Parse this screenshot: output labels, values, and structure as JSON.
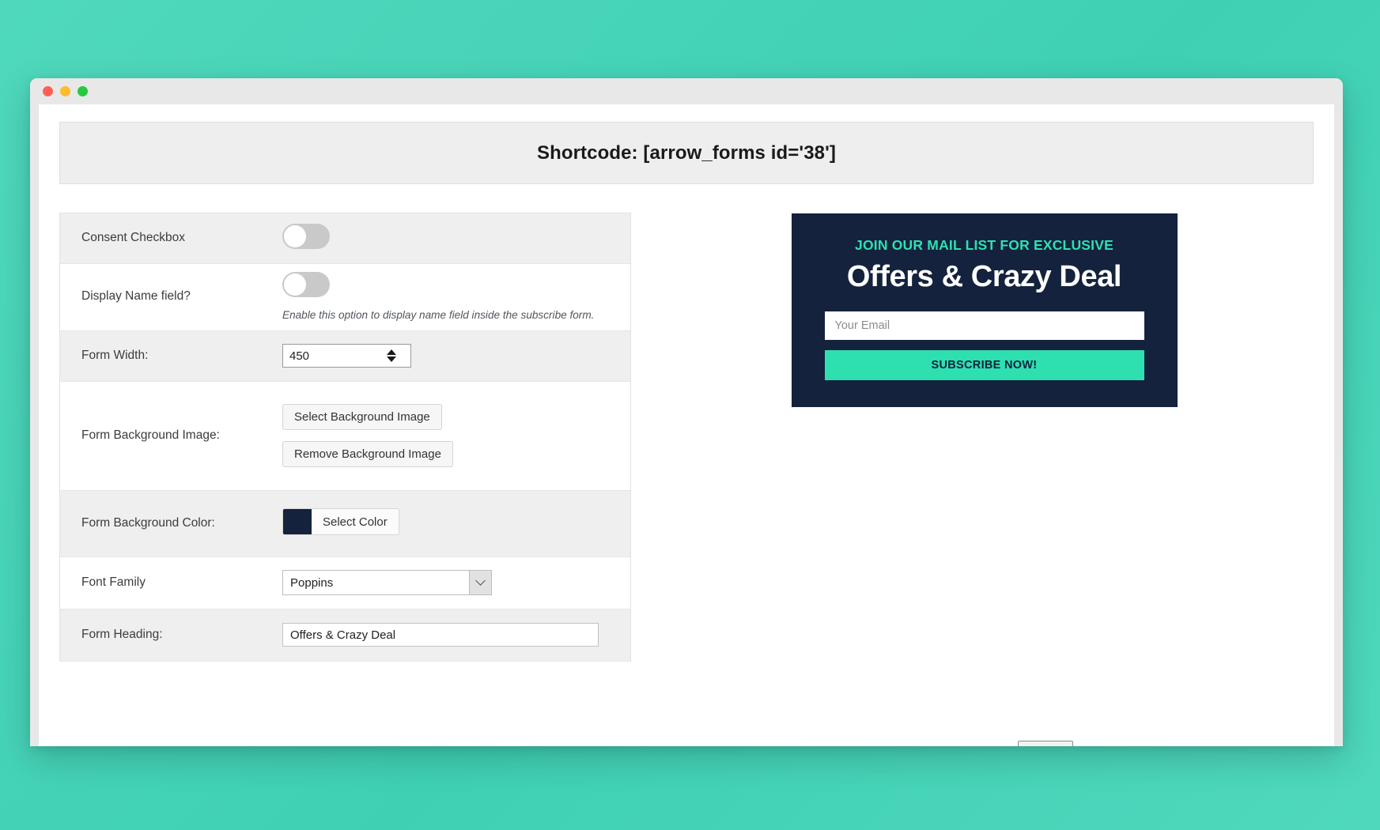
{
  "window": {
    "traffic_lights": [
      "close",
      "minimize",
      "maximize"
    ]
  },
  "shortcode": {
    "text": "Shortcode: [arrow_forms id='38']"
  },
  "settings": {
    "rows": [
      {
        "label": "Consent Checkbox",
        "control": "toggle",
        "toggle_state": "off",
        "help": ""
      },
      {
        "label": "Display Name field?",
        "control": "toggle",
        "toggle_state": "off",
        "help": "Enable this option to display name field inside the subscribe form."
      },
      {
        "label": "Form Width:",
        "control": "number",
        "value": "450"
      },
      {
        "label": "Form Background Image:",
        "control": "buttons",
        "buttons": [
          "Select Background Image",
          "Remove Background Image"
        ]
      },
      {
        "label": "Form Background Color:",
        "control": "color",
        "color_value": "#14223d",
        "color_label": "Select Color"
      },
      {
        "label": "Font Family",
        "control": "select",
        "value": "Poppins"
      },
      {
        "label": "Form Heading:",
        "control": "text",
        "value": "Offers & Crazy Deal"
      }
    ]
  },
  "preview": {
    "kicker": "JOIN OUR MAIL LIST FOR EXCLUSIVE",
    "heading": "Offers & Crazy Deal",
    "email_placeholder": "Your Email",
    "email_value": "",
    "button_label": "SUBSCRIBE NOW!",
    "colors": {
      "background": "#14223d",
      "kicker": "#2ee0b0",
      "button": "#2ee0b0",
      "button_text": "#14223d"
    }
  },
  "page_background": {
    "gradient_from": "#4fd8bc",
    "gradient_to": "#3fd0b4"
  }
}
